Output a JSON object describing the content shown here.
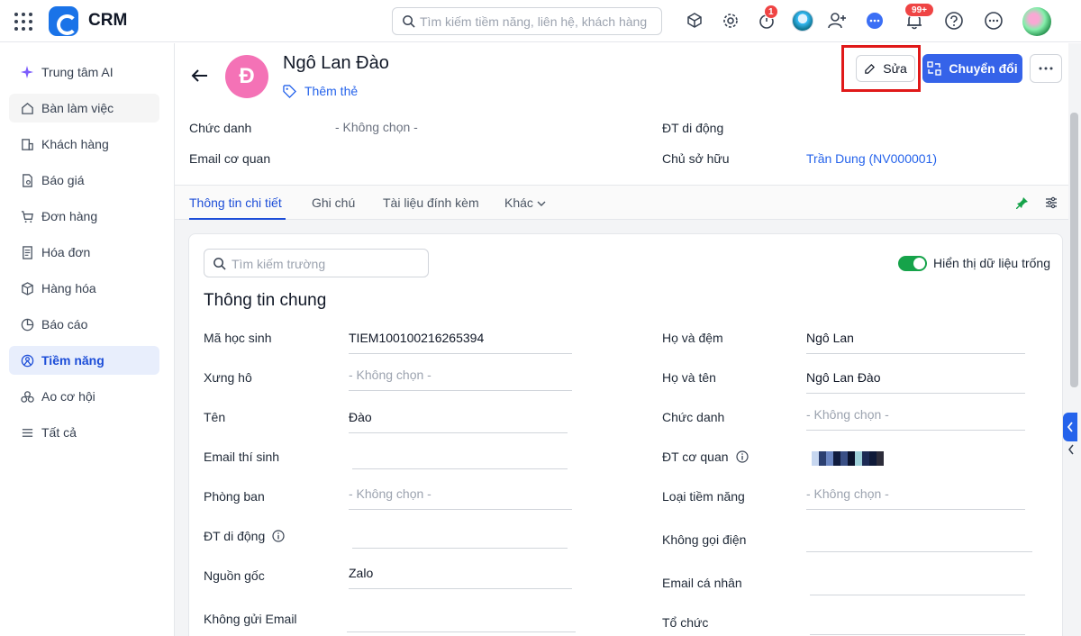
{
  "app": {
    "name": "CRM"
  },
  "search": {
    "placeholder": "Tìm kiếm tiềm năng, liên hệ, khách hàng"
  },
  "notifications": {
    "timer_badge": "1",
    "bell_badge": "99+"
  },
  "sidebar": {
    "items": [
      {
        "label": "Trung tâm AI",
        "icon": "sparkle-icon"
      },
      {
        "label": "Bàn làm việc",
        "icon": "home-icon"
      },
      {
        "label": "Khách hàng",
        "icon": "building-icon"
      },
      {
        "label": "Báo giá",
        "icon": "quote-doc-icon"
      },
      {
        "label": "Đơn hàng",
        "icon": "cart-icon"
      },
      {
        "label": "Hóa đơn",
        "icon": "invoice-icon"
      },
      {
        "label": "Hàng hóa",
        "icon": "box-icon"
      },
      {
        "label": "Báo cáo",
        "icon": "pie-chart-icon"
      },
      {
        "label": "Tiềm năng",
        "icon": "target-icon",
        "active": true
      },
      {
        "label": "Ao cơ hội",
        "icon": "handshake-icon"
      },
      {
        "label": "Tất cả",
        "icon": "menu-icon"
      }
    ]
  },
  "lead": {
    "avatar_letter": "Đ",
    "avatar_color": "#f472b6",
    "name": "Ngô Lan Đào",
    "add_tag": "Thêm thẻ"
  },
  "actions": {
    "edit": "Sửa",
    "convert": "Chuyển đổi"
  },
  "summary": {
    "job_title_label": "Chức danh",
    "job_title_value": "- Không chọn -",
    "work_email_label": "Email cơ quan",
    "mobile_label": "ĐT di động",
    "owner_label": "Chủ sở hữu",
    "owner_value": "Trần Dung (NV000001)"
  },
  "tabs": [
    {
      "label": "Thông tin chi tiết",
      "active": true
    },
    {
      "label": "Ghi chú"
    },
    {
      "label": "Tài liệu đính kèm"
    },
    {
      "label": "Khác"
    }
  ],
  "detail": {
    "field_search_placeholder": "Tìm kiếm trường",
    "show_empty_label": "Hiển thị dữ liệu trống",
    "show_empty_on": true,
    "section_title": "Thông tin chung",
    "left_fields": [
      {
        "label": "Mã học sinh",
        "value": "TIEM10010021626539 4"
      },
      {
        "label": "Xưng hô",
        "value": "- Không chọn -"
      },
      {
        "label": "Tên",
        "value": "Đào"
      },
      {
        "label": "Email thí sinh",
        "value": ""
      },
      {
        "label": "Phòng ban",
        "value": "- Không chọn -"
      },
      {
        "label": "ĐT di động",
        "value": ""
      },
      {
        "label": "Nguồn gốc",
        "value": "Zalo"
      },
      {
        "label": "Không gửi Email",
        "value": ""
      }
    ],
    "right_fields": [
      {
        "label": "Họ và đệm",
        "value": "Ngô Lan"
      },
      {
        "label": "Họ và tên",
        "value": "Ngô Lan Đào"
      },
      {
        "label": "Chức danh",
        "value": "- Không chọn -"
      },
      {
        "label": "ĐT cơ quan",
        "value": ""
      },
      {
        "label": "Loại tiềm năng",
        "value": "- Không chọn -"
      },
      {
        "label": "Không gọi điện",
        "value": ""
      },
      {
        "label": "Email cá nhân",
        "value": ""
      },
      {
        "label": "Tổ chức",
        "value": ""
      }
    ]
  },
  "colors": {
    "accent": "#3563e9",
    "link": "#2563eb",
    "highlight_box": "#e01919",
    "toggle_on": "#16a34a"
  }
}
